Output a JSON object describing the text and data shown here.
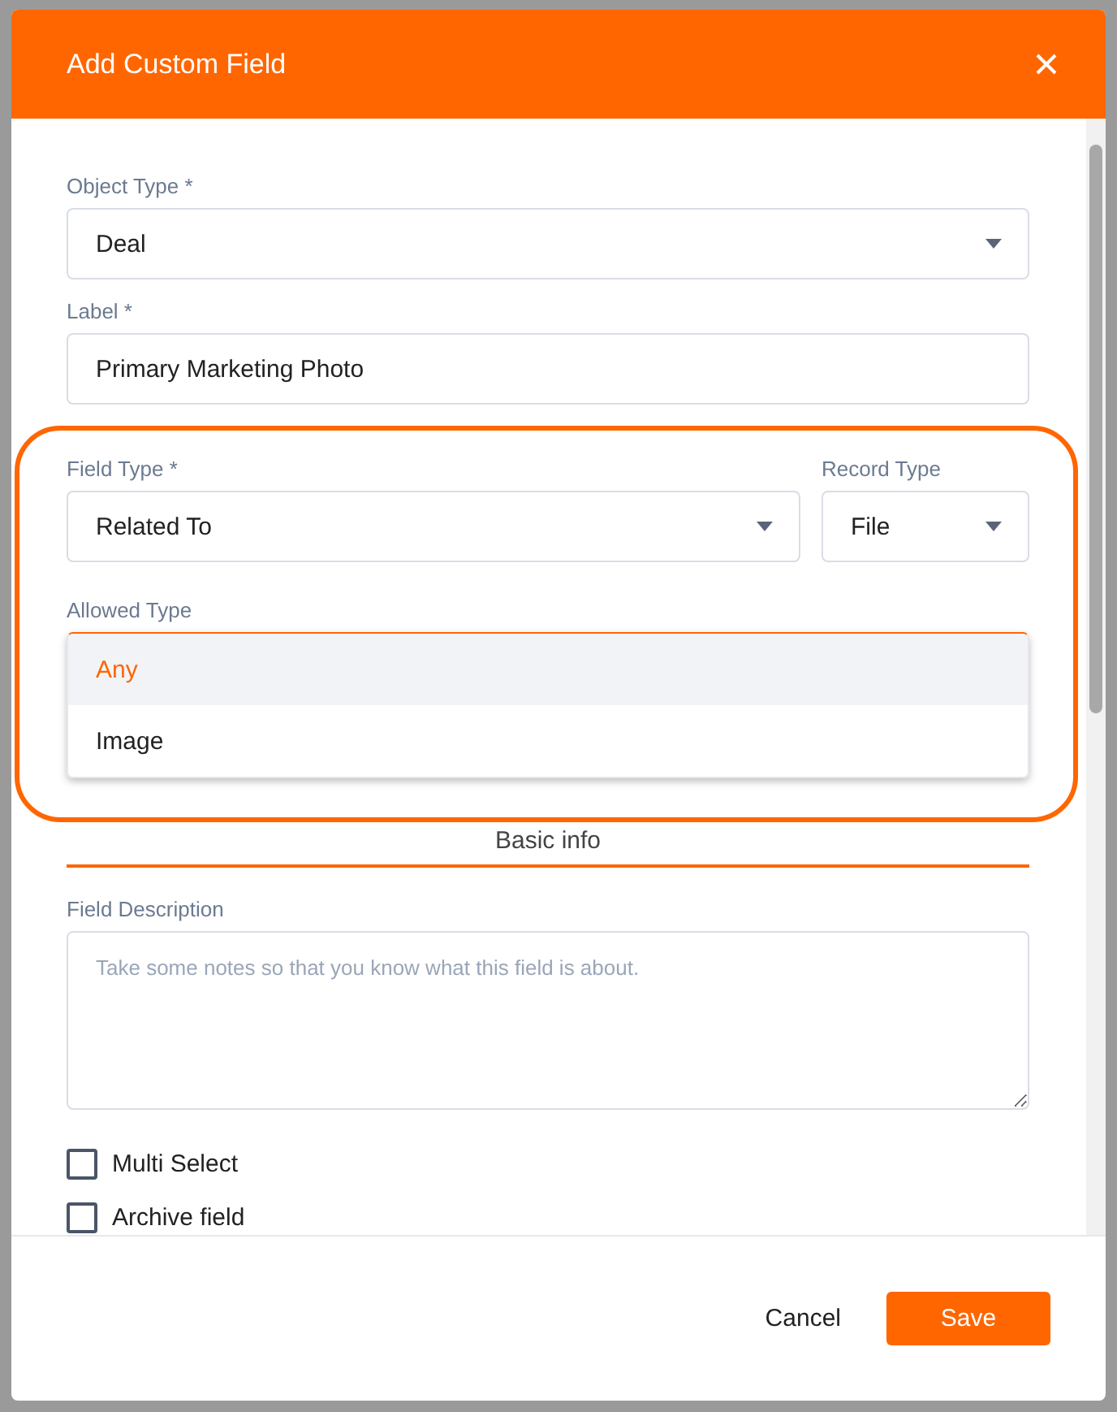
{
  "dialog": {
    "title": "Add Custom Field"
  },
  "object_type": {
    "label": "Object Type *",
    "value": "Deal"
  },
  "label_field": {
    "label": "Label *",
    "value": "Primary Marketing Photo"
  },
  "field_type": {
    "label": "Field Type *",
    "value": "Related To"
  },
  "record_type": {
    "label": "Record Type",
    "value": "File"
  },
  "allowed_type": {
    "label": "Allowed Type",
    "expanded": true,
    "options": [
      {
        "label": "Any",
        "selected": true
      },
      {
        "label": "Image",
        "selected": false
      }
    ]
  },
  "section_tab": {
    "label": "Basic info"
  },
  "field_description": {
    "label": "Field Description",
    "placeholder": "Take some notes so that you know what this field is about."
  },
  "checkboxes": [
    {
      "label": "Multi Select",
      "checked": false
    },
    {
      "label": "Archive field",
      "checked": false
    }
  ],
  "footer": {
    "cancel": "Cancel",
    "save": "Save"
  }
}
